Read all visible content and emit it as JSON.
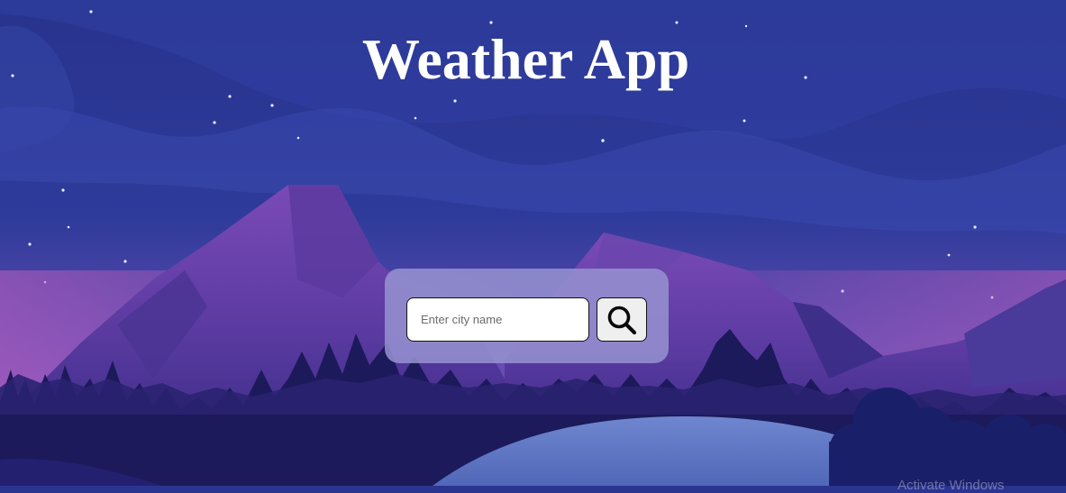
{
  "app": {
    "title": "Weather App"
  },
  "search": {
    "placeholder": "Enter city name",
    "value": "",
    "button_icon": "search-icon"
  },
  "colors": {
    "sky": "#2a3590",
    "card": "#9692d0",
    "title_text": "#ffffff"
  },
  "watermark": {
    "text": "Activate Windows"
  }
}
